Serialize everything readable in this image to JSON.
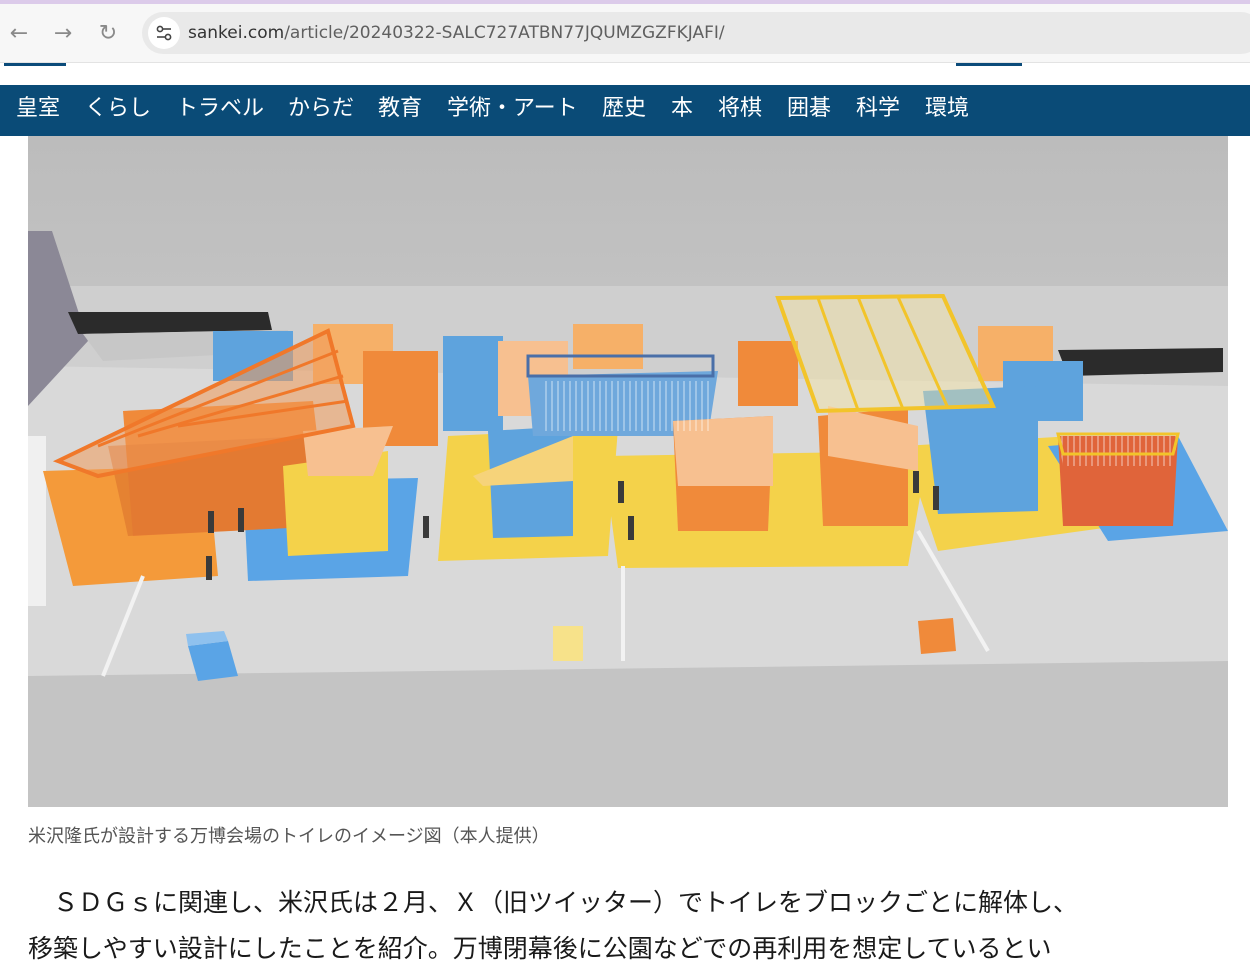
{
  "browser": {
    "url_domain": "sankei.com",
    "url_path": "/article/20240322-SALC727ATBN77JQUMZGZFKJAFI/",
    "back_icon": "←",
    "forward_icon": "→",
    "reload_icon": "↻"
  },
  "nav": {
    "items": [
      "皇室",
      "くらし",
      "トラベル",
      "からだ",
      "教育",
      "学術・アート",
      "歴史",
      "本",
      "将棋",
      "囲碁",
      "科学",
      "環境"
    ]
  },
  "article": {
    "caption": "米沢隆氏が設計する万博会場のトイレのイメージ図（本人提供）",
    "body_line1": "　ＳＤＧｓに関連し、米沢氏は２月、Ｘ（旧ツイッター）でトイレをブロックごとに解体し、",
    "body_line2": "移築しやすい設計にしたことを紹介。万博閉幕後に公園などでの再利用を想定しているとい"
  },
  "colors": {
    "nav_bg": "#0a4b77",
    "caption": "#555555",
    "orange": "#f08a3a",
    "blue": "#5ea3dd",
    "yellow": "#f4d24a"
  }
}
